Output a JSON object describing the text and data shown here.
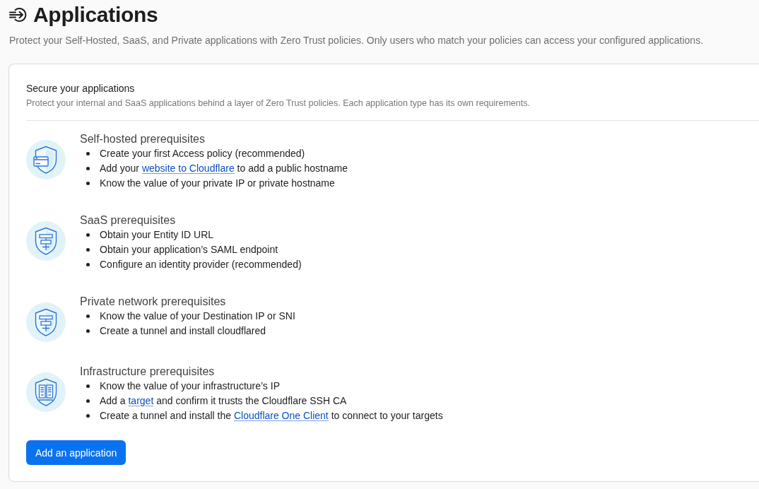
{
  "header": {
    "title": "Applications",
    "subtitle": "Protect your Self-Hosted, SaaS, and Private applications with Zero Trust policies. Only users who match your policies can access your configured applications."
  },
  "card": {
    "title": "Secure your applications",
    "description": "Protect your internal and SaaS applications behind a layer of Zero Trust policies. Each application type has its own requirements.",
    "sections": [
      {
        "kind": "card",
        "title": "Self-hosted prerequisites",
        "items": [
          {
            "parts": [
              {
                "kind": "text",
                "text": "Create your first Access policy (recommended)"
              }
            ]
          },
          {
            "parts": [
              {
                "kind": "text",
                "text": "Add your "
              },
              {
                "kind": "link",
                "text": "website to Cloudflare"
              },
              {
                "kind": "text",
                "text": " to add a public hostname"
              }
            ]
          },
          {
            "parts": [
              {
                "kind": "text",
                "text": "Know the value of your private IP or private hostname"
              }
            ]
          }
        ]
      },
      {
        "kind": "network",
        "title": "SaaS prerequisites",
        "items": [
          {
            "parts": [
              {
                "kind": "text",
                "text": "Obtain your Entity ID URL"
              }
            ]
          },
          {
            "parts": [
              {
                "kind": "text",
                "text": "Obtain your application’s SAML endpoint"
              }
            ]
          },
          {
            "parts": [
              {
                "kind": "text",
                "text": "Configure an identity provider (recommended)"
              }
            ]
          }
        ]
      },
      {
        "kind": "network",
        "title": "Private network prerequisites",
        "items": [
          {
            "parts": [
              {
                "kind": "text",
                "text": "Know the value of your Destination IP or SNI"
              }
            ]
          },
          {
            "parts": [
              {
                "kind": "text",
                "text": "Create a tunnel and install cloudflared"
              }
            ]
          }
        ]
      },
      {
        "kind": "server",
        "title": "Infrastructure prerequisites",
        "items": [
          {
            "parts": [
              {
                "kind": "text",
                "text": "Know the value of your infrastructure’s IP"
              }
            ]
          },
          {
            "parts": [
              {
                "kind": "text",
                "text": "Add a "
              },
              {
                "kind": "link",
                "text": "target"
              },
              {
                "kind": "text",
                "text": " and confirm it trusts the Cloudflare SSH CA"
              }
            ]
          },
          {
            "parts": [
              {
                "kind": "text",
                "text": "Create a tunnel and install the "
              },
              {
                "kind": "link",
                "text": "Cloudflare One Client"
              },
              {
                "kind": "text",
                "text": " to connect to your targets"
              }
            ]
          }
        ]
      }
    ],
    "button": "Add an application"
  }
}
